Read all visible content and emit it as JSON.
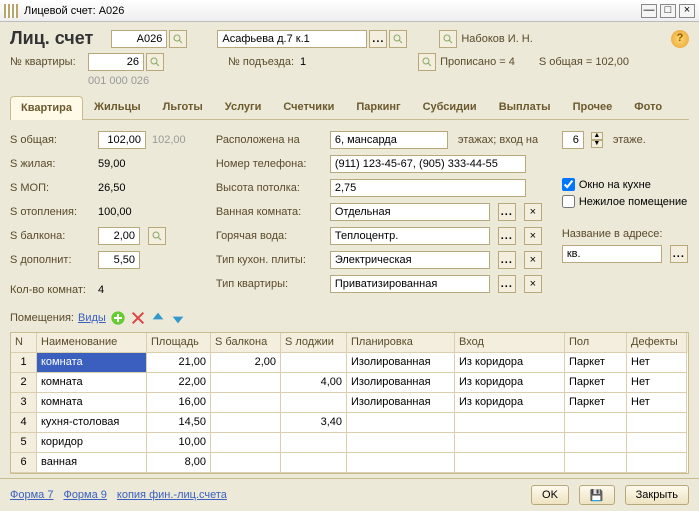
{
  "window": {
    "title": "Лицевой счет: А026"
  },
  "header": {
    "title": "Лиц. счет",
    "account": "А026",
    "address": "Асафьева д.7 к.1",
    "owner_label": "Набоков И. Н.",
    "apt_label": "№ квартиры:",
    "apt_no": "26",
    "apt_code": "001 000 026",
    "entrance_label": "№ подъезда:",
    "entrance": "1",
    "registered_label": "Прописано = 4",
    "area_total_label": "S общая = 102,00"
  },
  "tabs": [
    "Квартира",
    "Жильцы",
    "Льготы",
    "Услуги",
    "Счетчики",
    "Паркинг",
    "Субсидии",
    "Выплаты",
    "Прочее",
    "Фото"
  ],
  "left": {
    "s_total_label": "S общая:",
    "s_total": "102,00",
    "s_total_faint": "102,00",
    "s_living_label": "S жилая:",
    "s_living": "59,00",
    "s_mop_label": "S МОП:",
    "s_mop": "26,50",
    "s_heat_label": "S отопления:",
    "s_heat": "100,00",
    "s_balcony_label": "S балкона:",
    "s_balcony": "2,00",
    "s_extra_label": "S дополнит:",
    "s_extra": "5,50",
    "rooms_label": "Кол-во комнат:",
    "rooms": "4"
  },
  "mid": {
    "located_label": "Расположена на",
    "located": "6, мансарда",
    "floors_label": "этажах;  вход на",
    "entry_floor": "6",
    "floor_label": "этаже.",
    "phone_label": "Номер телефона:",
    "phone": "(911) 123-45-67, (905) 333-44-55",
    "ceil_label": "Высота потолка:",
    "ceil": "2,75",
    "bath_label": "Ванная комната:",
    "bath": "Отдельная",
    "hot_label": "Горячая вода:",
    "hot": "Теплоцентр.",
    "stove_label": "Тип кухон. плиты:",
    "stove": "Электрическая",
    "apttype_label": "Тип квартиры:",
    "apttype": "Приватизированная"
  },
  "right": {
    "kitchen_window": "Окно на кухне",
    "nonres": "Нежилое помещение",
    "addrname_label": "Название в адресе:",
    "addrname": "кв."
  },
  "rooms_block": {
    "label": "Помещения:",
    "views": "Виды",
    "cols": [
      "N",
      "Наименование",
      "Площадь",
      "S балкона",
      "S лоджии",
      "Планировка",
      "Вход",
      "Пол",
      "Дефекты"
    ],
    "rows": [
      {
        "n": "1",
        "name": "комната",
        "area": "21,00",
        "balc": "2,00",
        "lodg": "",
        "plan": "Изолированная",
        "ent": "Из коридора",
        "floor": "Паркет",
        "def": "Нет"
      },
      {
        "n": "2",
        "name": "комната",
        "area": "22,00",
        "balc": "",
        "lodg": "4,00",
        "plan": "Изолированная",
        "ent": "Из коридора",
        "floor": "Паркет",
        "def": "Нет"
      },
      {
        "n": "3",
        "name": "комната",
        "area": "16,00",
        "balc": "",
        "lodg": "",
        "plan": "Изолированная",
        "ent": "Из коридора",
        "floor": "Паркет",
        "def": "Нет"
      },
      {
        "n": "4",
        "name": "кухня-столовая",
        "area": "14,50",
        "balc": "",
        "lodg": "3,40",
        "plan": "",
        "ent": "",
        "floor": "",
        "def": ""
      },
      {
        "n": "5",
        "name": "коридор",
        "area": "10,00",
        "balc": "",
        "lodg": "",
        "plan": "",
        "ent": "",
        "floor": "",
        "def": ""
      },
      {
        "n": "6",
        "name": "ванная",
        "area": "8,00",
        "balc": "",
        "lodg": "",
        "plan": "",
        "ent": "",
        "floor": "",
        "def": ""
      }
    ]
  },
  "footer": {
    "form7": "Форма 7",
    "form9": "Форма 9",
    "copy": "копия фин.-лиц.счета",
    "ok": "OK",
    "close": "Закрыть"
  }
}
